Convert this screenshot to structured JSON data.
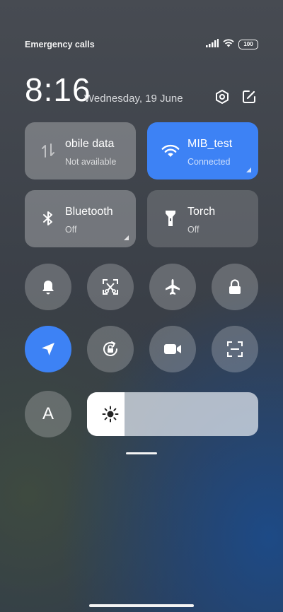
{
  "status": {
    "carrier_text": "Emergency calls o",
    "battery": "100",
    "icons": [
      "signal-icon",
      "wifi-icon",
      "battery-icon"
    ]
  },
  "header": {
    "time": "8:16",
    "date": "Wednesday, 19 June",
    "icons": [
      "settings-icon",
      "edit-icon"
    ]
  },
  "tiles": [
    {
      "id": "mobile-data",
      "title": "obile data",
      "subtitle": "Not available",
      "icon": "mobile-data-icon",
      "state": "off"
    },
    {
      "id": "wifi",
      "title": "MIB_test",
      "subtitle": "Connected",
      "icon": "wifi-icon",
      "state": "on"
    },
    {
      "id": "bluetooth",
      "title": "Bluetooth",
      "subtitle": "Off",
      "icon": "bluetooth-icon",
      "state": "off"
    },
    {
      "id": "torch",
      "title": "Torch",
      "subtitle": "Off",
      "icon": "torch-icon",
      "state": "off"
    }
  ],
  "toggles_row1": [
    "bell-icon",
    "screenshot-icon",
    "airplane-icon",
    "lock-icon"
  ],
  "toggles_row2": [
    "location-icon",
    "rotation-lock-icon",
    "video-camera-icon",
    "scan-icon"
  ],
  "font_toggle": {
    "label": "A"
  },
  "brightness": {
    "level": 0.22
  },
  "colors": {
    "accent": "#3d82f5"
  }
}
